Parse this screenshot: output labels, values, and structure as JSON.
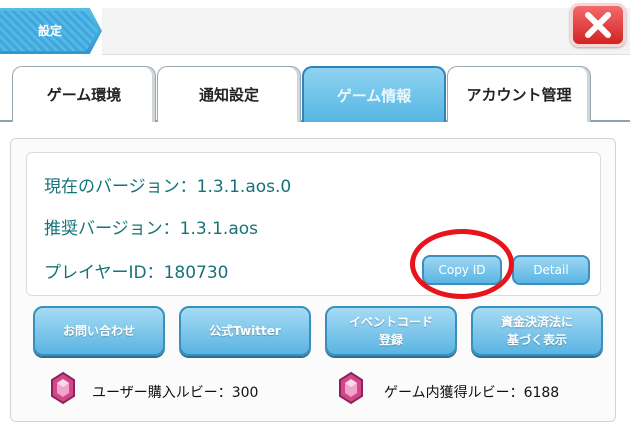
{
  "header": {
    "title": "設定"
  },
  "tabs": [
    {
      "label": "ゲーム環境",
      "active": false
    },
    {
      "label": "通知設定",
      "active": false
    },
    {
      "label": "ゲーム情報",
      "active": true
    },
    {
      "label": "アカウント管理",
      "active": false
    }
  ],
  "info": {
    "current_version": "現在のバージョン：1.3.1.aos.0",
    "recommended_version": "推奨バージョン：1.3.1.aos",
    "player_id": "プレイヤーID：180730",
    "copy_id_label": "Copy ID",
    "detail_label": "Detail"
  },
  "actions": [
    {
      "line1": "お問い合わせ",
      "line2": ""
    },
    {
      "line1": "公式Twitter",
      "line2": ""
    },
    {
      "line1": "イベントコード",
      "line2": "登録"
    },
    {
      "line1": "資金決済法に",
      "line2": "基づく表示"
    }
  ],
  "rubies": {
    "purchased": "ユーザー購入ルビー：300",
    "earned": "ゲーム内獲得ルビー：6188"
  },
  "colors": {
    "accent": "#55b6e3",
    "close": "#d32222",
    "info_text": "#157378",
    "highlight": "#e8141c",
    "ruby": "#d2478c"
  }
}
